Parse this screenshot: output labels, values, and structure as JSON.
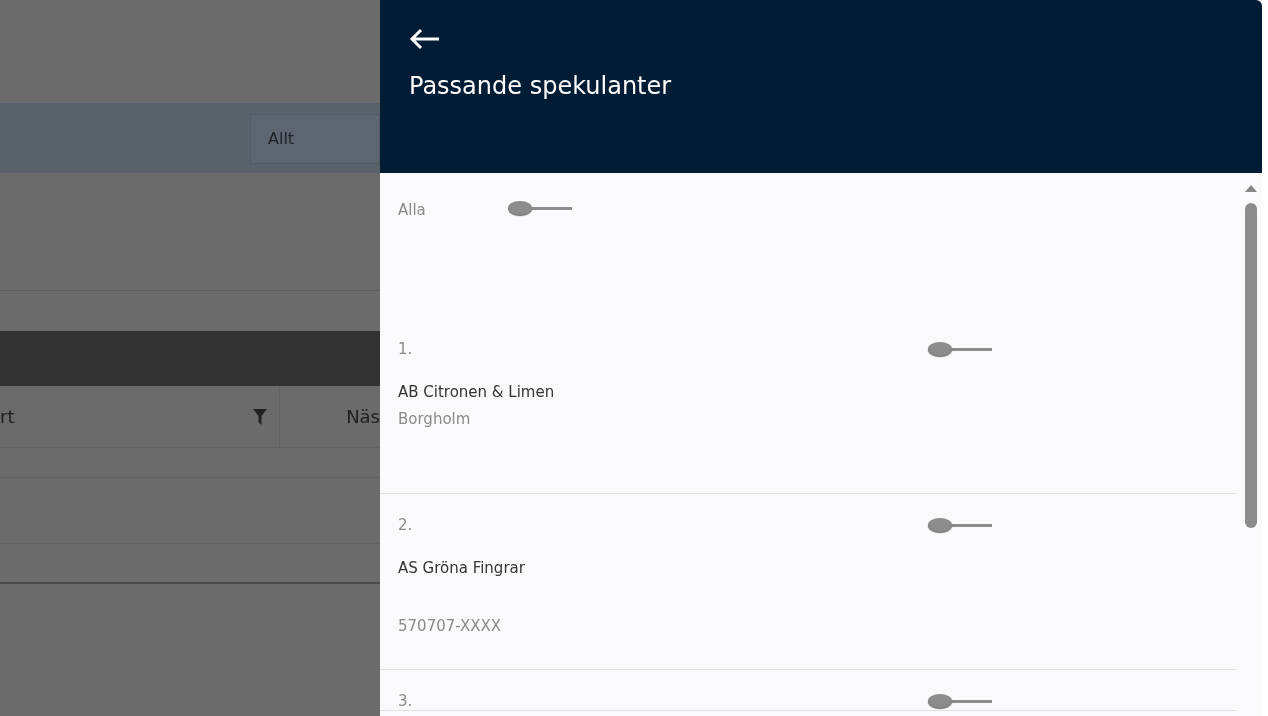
{
  "background": {
    "filter_field": {
      "value": "Allt"
    },
    "table_columns": [
      {
        "label": "rt",
        "filter": true
      },
      {
        "label": "Näs",
        "filter": false
      }
    ]
  },
  "panel": {
    "title": "Passande spekulanter",
    "all_toggle": {
      "label": "Alla",
      "on": false
    },
    "items": [
      {
        "number": "1.",
        "name": "AB Citronen & Limen",
        "detail": "Borgholm",
        "on": false
      },
      {
        "number": "2.",
        "name": "AS Gröna Fingrar",
        "detail": "570707-XXXX",
        "on": false
      },
      {
        "number": "3.",
        "on": false
      }
    ]
  }
}
